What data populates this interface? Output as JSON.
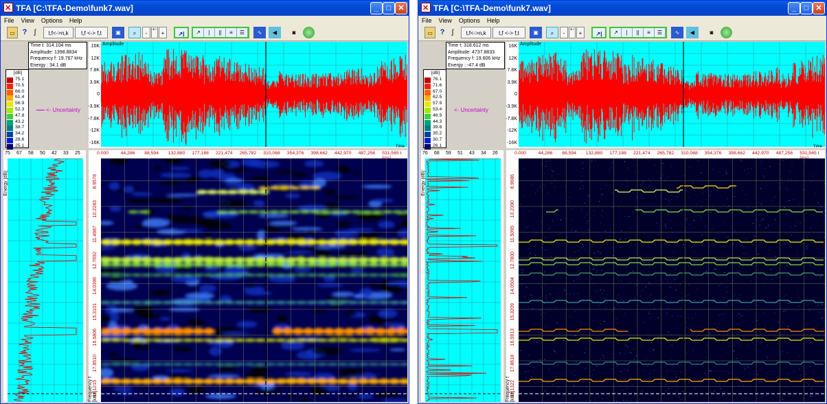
{
  "windows": [
    {
      "title": "TFA [C:\\TFA-Demo\\funk7.wav]",
      "menu": [
        "File",
        "View",
        "Options",
        "Help"
      ],
      "toolbar": {
        "tf_to_nk": "t,f<->n,k",
        "tf_to_ft": "t,f <-> f,t"
      },
      "info": {
        "time": "Time t: 314.104 ms",
        "amplitude": "Amplitude: 1398.8834",
        "frequency": "Frequency f: 19.767 kHz",
        "energy": "Energy : 34.1 dB"
      },
      "legend": {
        "unit": "[dB]",
        "levels": [
          "75.1",
          "70.5",
          "66.0",
          "61.4",
          "56.9",
          "52.3",
          "47.8",
          "43.2",
          "38.7",
          "34.2",
          "29.6",
          "25.1"
        ]
      },
      "uncertainty": "<- Uncertainty",
      "amplitude_title": "Amplitude",
      "amplitude_ticks": [
        "16K",
        "12K",
        "7.8K",
        "3.9K",
        "0",
        "-3.9K",
        "-7.8K",
        "-12K",
        "-16K"
      ],
      "time_label": "Time",
      "time_ticks": [
        "0.000",
        "44,286",
        "88,594",
        "132,880",
        "177,188",
        "221,474",
        "265,782",
        "310,068",
        "354,376",
        "398,662",
        "442,970",
        "487,256",
        "531,565 t [ms]"
      ],
      "energy_ticks": [
        "75",
        "67",
        "58",
        "50",
        "42",
        "33",
        "25"
      ],
      "energy_label": "Energy [dB]",
      "freq_ticks": [
        "8.9578",
        "10.2283",
        "11.4987",
        "12.7692",
        "14.0396",
        "15.3101",
        "16.5806",
        "17.8510",
        "19.1215"
      ],
      "freq_label": "Frequency f [kHz]",
      "spectrogram_style": "blurred"
    },
    {
      "title": "TFA [C:\\TFA-Demo\\funk7.wav]",
      "menu": [
        "File",
        "View",
        "Options",
        "Help"
      ],
      "toolbar": {
        "tf_to_nk": "t,f<->n,k",
        "tf_to_ft": "t,f <-> f,t"
      },
      "info": {
        "time": "Time t: 318.612 ms",
        "amplitude": "Amplitude: 4737.8833",
        "frequency": "Frequency f: 19.606 kHz",
        "energy": "Energy : -47.4 dB"
      },
      "legend": {
        "unit": "[dB]",
        "levels": [
          "76.1",
          "71.6",
          "67.0",
          "62.5",
          "57.9",
          "53.4",
          "48.9",
          "44.3",
          "39.8",
          "35.2",
          "30.7",
          "26.1"
        ]
      },
      "uncertainty": "<- Uncertainty",
      "amplitude_title": "Amplitude",
      "amplitude_ticks": [
        "16K",
        "12K",
        "7.8K",
        "3.9K",
        "0",
        "-3.9K",
        "-7.8K",
        "-12K",
        "-16K"
      ],
      "time_label": "Time",
      "time_ticks": [
        "0.000",
        "44,286",
        "88,594",
        "132,880",
        "177,188",
        "221,474",
        "265,782",
        "310,068",
        "354,376",
        "398,662",
        "442,970",
        "487,256",
        "531,565 t [ms]"
      ],
      "energy_ticks": [
        "76",
        "68",
        "59",
        "51",
        "43",
        "34",
        "26"
      ],
      "energy_label": "Energy [dB]",
      "freq_ticks": [
        "8.9686",
        "10.2390",
        "11.5095",
        "12.7800",
        "14.0504",
        "15.3209",
        "16.5913",
        "17.8618",
        "19.1322"
      ],
      "freq_label": "Frequency f [kHz]",
      "spectrogram_style": "sharp"
    }
  ],
  "colors": {
    "plot_bg": "#00ffff",
    "waveform": "#ff0000",
    "cursor": "#000000",
    "legend": [
      "#c00000",
      "#ff2000",
      "#ff6000",
      "#ffb000",
      "#e8e800",
      "#a8e800",
      "#40d040",
      "#00a080",
      "#008080",
      "#0040a0",
      "#0020d0",
      "#000070"
    ]
  }
}
